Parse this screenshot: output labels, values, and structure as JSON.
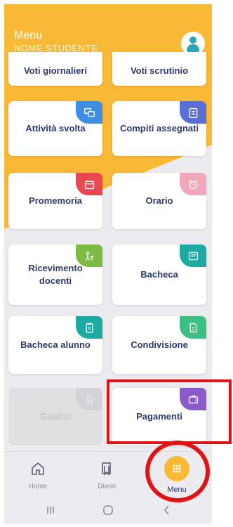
{
  "header": {
    "title": "Menu",
    "student_name": "NOME STUDENTE"
  },
  "icons": {
    "avatar": "user-avatar-icon",
    "attivita": "chat-bubbles-icon",
    "compiti": "clipboard-icon",
    "promemoria": "calendar-icon",
    "orario": "alarm-clock-icon",
    "ricevimento": "teacher-desk-icon",
    "bacheca": "bulletin-board-icon",
    "bacheca_alunno": "clipboard-list-icon",
    "condivisione": "document-share-icon",
    "giudizi": "badge-icon",
    "pagamenti": "wallet-icon"
  },
  "colors": {
    "brand_yellow": "#f8b936",
    "text_dark_blue": "#2d3a6e",
    "blue": "#3f8ee6",
    "indigo": "#5a6fd6",
    "red": "#e94a52",
    "pink": "#f2a8bc",
    "green": "#7dbb45",
    "teal": "#1fa9a3",
    "green_light": "#3cbf83",
    "purple": "#8a5cc8",
    "highlight_red": "#e01414"
  },
  "menu": {
    "voti_giornalieri": "Voti giornalieri",
    "voti_scrutinio": "Voti scrutinio",
    "attivita_svolta": "Attività svolta",
    "compiti_assegnati": "Compiti assegnati",
    "promemoria": "Promemoria",
    "orario": "Orario",
    "ricevimento_docenti": "Ricevimento docenti",
    "bacheca": "Bacheca",
    "bacheca_alunno": "Bacheca alunno",
    "condivisione": "Condivisione",
    "giudizi": "Giudizi",
    "pagamenti": "Pagamenti"
  },
  "bottom_nav": {
    "home": "Home",
    "diario": "Diario",
    "menu": "Menu"
  }
}
